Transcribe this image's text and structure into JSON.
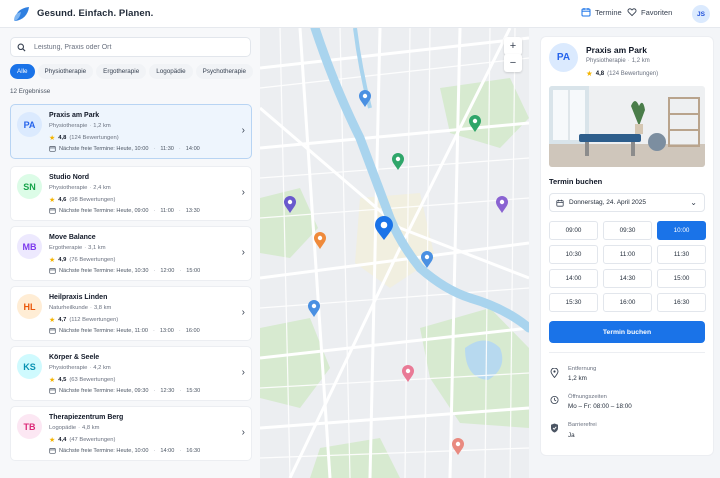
{
  "header": {
    "brand": "Gesund. Einfach. Planen.",
    "nav": [
      {
        "label": "Termine",
        "icon": "calendar-icon"
      },
      {
        "label": "Favoriten",
        "icon": "heart-icon"
      }
    ],
    "user_initials": "JS"
  },
  "search": {
    "placeholder": "Leistung, Praxis oder Ort",
    "value": ""
  },
  "filters": [
    "Alle",
    "Physiotherapie",
    "Ergotherapie",
    "Logopädie",
    "Psychotherapie"
  ],
  "active_filter": "Alle",
  "result_count": "12 Ergebnisse",
  "results": [
    {
      "initials": "PA",
      "name": "Praxis am Park",
      "category": "Physiotherapie",
      "distance": "1,2 km",
      "rating": "4,8",
      "reviews": "(124 Bewertungen)",
      "slots_label": "Nächste freie Termine: Heute, 10:00",
      "slot_times": [
        "11:30",
        "14:00"
      ],
      "selected": true,
      "color_bg": "#dbeafe",
      "color_fg": "#2563eb"
    },
    {
      "initials": "SN",
      "name": "Studio Nord",
      "category": "Physiotherapie",
      "distance": "2,4 km",
      "rating": "4,6",
      "reviews": "(98 Bewertungen)",
      "slots_label": "Nächste freie Termine: Heute, 09:00",
      "slot_times": [
        "11:00",
        "13:30"
      ],
      "selected": false,
      "color_bg": "#dcfce7",
      "color_fg": "#16a34a"
    },
    {
      "initials": "MB",
      "name": "Move Balance",
      "category": "Ergotherapie",
      "distance": "3,1 km",
      "rating": "4,9",
      "reviews": "(76 Bewertungen)",
      "slots_label": "Nächste freie Termine: Heute, 10:30",
      "slot_times": [
        "12:00",
        "15:00"
      ],
      "selected": false,
      "color_bg": "#ede9fe",
      "color_fg": "#7c3aed"
    },
    {
      "initials": "HL",
      "name": "Heilpraxis Linden",
      "category": "Naturheilkunde",
      "distance": "3,8 km",
      "rating": "4,7",
      "reviews": "(112 Bewertungen)",
      "slots_label": "Nächste freie Termine: Heute, 11:00",
      "slot_times": [
        "13:00",
        "16:00"
      ],
      "selected": false,
      "color_bg": "#ffedd5",
      "color_fg": "#ea580c"
    },
    {
      "initials": "KS",
      "name": "Körper & Seele",
      "category": "Physiotherapie",
      "distance": "4,2 km",
      "rating": "4,5",
      "reviews": "(63 Bewertungen)",
      "slots_label": "Nächste freie Termine: Heute, 09:30",
      "slot_times": [
        "12:30",
        "15:30"
      ],
      "selected": false,
      "color_bg": "#cffafe",
      "color_fg": "#0891b2"
    },
    {
      "initials": "TB",
      "name": "Therapiezentrum Berg",
      "category": "Logopädie",
      "distance": "4,8 km",
      "rating": "4,4",
      "reviews": "(47 Bewertungen)",
      "slots_label": "Nächste freie Termine: Heute, 10:00",
      "slot_times": [
        "14:00",
        "16:30"
      ],
      "selected": false,
      "color_bg": "#fce7f3",
      "color_fg": "#db2777"
    }
  ],
  "map": {
    "zoom_in": "+",
    "zoom_out": "−",
    "pins": [
      {
        "name": "map-pin-blue",
        "color": "#4a90e2"
      },
      {
        "name": "map-pin-green",
        "color": "#2fa66a"
      },
      {
        "name": "map-pin-green",
        "color": "#2fa66a"
      },
      {
        "name": "map-pin-purple",
        "color": "#6a5acd"
      },
      {
        "name": "map-pin-selected",
        "color": "#1a73e8"
      },
      {
        "name": "map-pin-purple",
        "color": "#8a63d2"
      },
      {
        "name": "map-pin-orange",
        "color": "#ef8a3b"
      },
      {
        "name": "map-pin-blue",
        "color": "#4a90e2"
      },
      {
        "name": "map-pin-blue",
        "color": "#4a90e2"
      },
      {
        "name": "map-pin-pink",
        "color": "#e97a96"
      },
      {
        "name": "map-pin-coral",
        "color": "#e98a80"
      }
    ]
  },
  "detail": {
    "initials": "PA",
    "name": "Praxis am Park",
    "category": "Physiotherapie",
    "distance": "1,2 km",
    "rating": "4,8",
    "reviews": "(124 Bewertungen)",
    "booking_title": "Termin buchen",
    "date": "Donnerstag, 24. April 2025",
    "times": [
      "09:00",
      "09:30",
      "10:00",
      "10:30",
      "11:00",
      "11:30",
      "14:00",
      "14:30",
      "15:00",
      "15:30",
      "16:00",
      "16:30"
    ],
    "selected_time": "10:00",
    "book_button": "Termin buchen",
    "info": [
      {
        "label": "Entfernung",
        "value": "1,2 km",
        "icon": "location-icon"
      },
      {
        "label": "Öffnungszeiten",
        "value": "Mo – Fr: 08:00 – 18:00",
        "icon": "clock-icon"
      },
      {
        "label": "Barrierefrei",
        "value": "Ja",
        "icon": "shield-icon"
      }
    ]
  },
  "colors": {
    "accent": "#1a73e8",
    "star": "#f4b400",
    "water": "#a9d4ee",
    "park": "#cfe6c2"
  }
}
